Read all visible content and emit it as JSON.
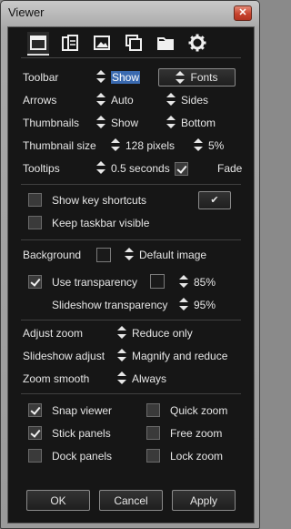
{
  "window": {
    "title": "Viewer",
    "close_glyph": "✕"
  },
  "tabs": [
    {
      "icon": "window-icon",
      "active": true
    },
    {
      "icon": "panels-icon"
    },
    {
      "icon": "image-icon"
    },
    {
      "icon": "copy-windows-icon"
    },
    {
      "icon": "folder-icon"
    },
    {
      "icon": "gear-icon"
    }
  ],
  "toolbar": {
    "label": "Toolbar",
    "value": "Show",
    "fonts_button": "Fonts"
  },
  "arrows": {
    "label": "Arrows",
    "value": "Auto",
    "position": "Sides"
  },
  "thumbnails": {
    "label": "Thumbnails",
    "value": "Show",
    "position": "Bottom"
  },
  "thumbnail_size": {
    "label": "Thumbnail size",
    "value": "128 pixels",
    "percent": "5%"
  },
  "tooltips": {
    "label": "Tooltips",
    "value": "0.5 seconds",
    "fade_label": "Fade",
    "fade_checked": true
  },
  "key_shortcuts": {
    "label": "Show key shortcuts",
    "checked": false,
    "button_glyph": "✔"
  },
  "taskbar": {
    "label": "Keep taskbar visible",
    "checked": false
  },
  "background": {
    "label": "Background",
    "image_value": "Default image"
  },
  "transparency": {
    "label": "Use transparency",
    "checked": true,
    "value": "85%"
  },
  "slideshow_transparency": {
    "label": "Slideshow transparency",
    "value": "95%"
  },
  "adjust_zoom": {
    "label": "Adjust zoom",
    "value": "Reduce only"
  },
  "slideshow_adjust": {
    "label": "Slideshow adjust",
    "value": "Magnify and reduce"
  },
  "zoom_smooth": {
    "label": "Zoom smooth",
    "value": "Always"
  },
  "checks": {
    "snap_viewer": {
      "label": "Snap viewer",
      "checked": true
    },
    "quick_zoom": {
      "label": "Quick zoom",
      "checked": false
    },
    "stick_panels": {
      "label": "Stick panels",
      "checked": true
    },
    "free_zoom": {
      "label": "Free zoom",
      "checked": false
    },
    "dock_panels": {
      "label": "Dock panels",
      "checked": false
    },
    "lock_zoom": {
      "label": "Lock zoom",
      "checked": false
    }
  },
  "buttons": {
    "ok": "OK",
    "cancel": "Cancel",
    "apply": "Apply"
  },
  "colors": {
    "client_bg": "#161616",
    "highlight": "#3a6ab0",
    "text": "#e6e6e6"
  }
}
